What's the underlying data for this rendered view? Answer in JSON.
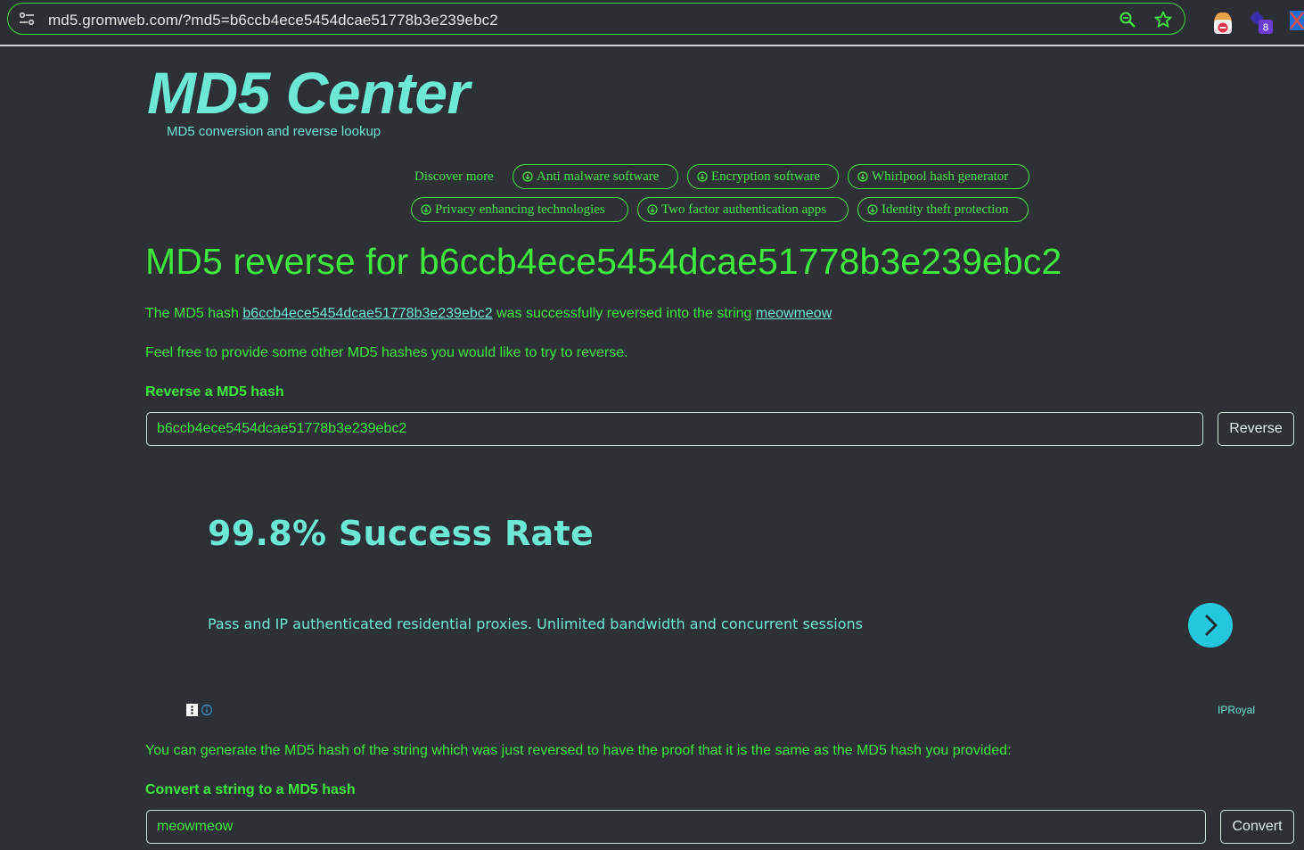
{
  "browser": {
    "url": "md5.gromweb.com/?md5=b6ccb4ece5454dcae51778b3e239ebc2",
    "extension_badge": "8"
  },
  "header": {
    "logo": "MD5 Center",
    "tagline": "MD5 conversion and reverse lookup"
  },
  "discover": {
    "label": "Discover more",
    "links": [
      "Anti malware software",
      "Encryption software",
      "Whirlpool hash generator",
      "Privacy enhancing technologies",
      "Two factor authentication apps",
      "Identity theft protection"
    ]
  },
  "main": {
    "headline": "MD5 reverse for b6ccb4ece5454dcae51778b3e239ebc2",
    "result_prefix": "The MD5 hash ",
    "result_hash": "b6ccb4ece5454dcae51778b3e239ebc2",
    "result_middle": " was successfully reversed into the string ",
    "result_string": "meowmeow",
    "prompt": "Feel free to provide some other MD5 hashes you would like to try to reverse.",
    "reverse_label": "Reverse a MD5 hash",
    "reverse_value": "b6ccb4ece5454dcae51778b3e239ebc2",
    "reverse_button": "Reverse",
    "proof_text": "You can generate the MD5 hash of the string which was just reversed to have the proof that it is the same as the MD5 hash you provided:",
    "convert_label": "Convert a string to a MD5 hash",
    "convert_value": "meowmeow",
    "convert_button": "Convert"
  },
  "ad": {
    "title": "99.8% Success Rate",
    "text": "Pass and IP authenticated residential proxies. Unlimited bandwidth and concurrent sessions",
    "brand": "IPRoyal"
  },
  "colors": {
    "background": "#2d3035",
    "green": "#3ee83e",
    "teal": "#6de8d3",
    "ad_button": "#25c7dc"
  }
}
